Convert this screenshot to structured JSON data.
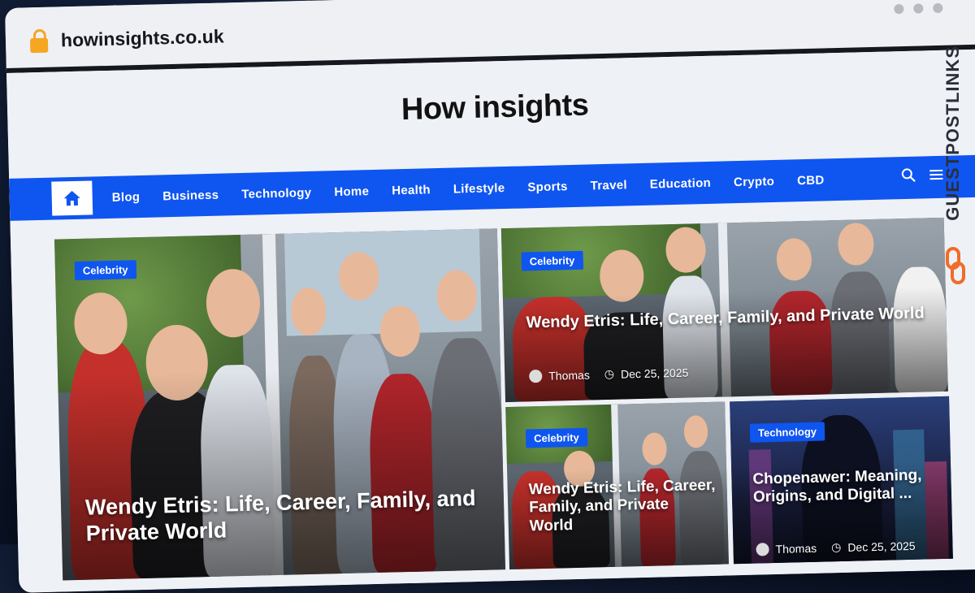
{
  "browser": {
    "url": "howinsights.co.uk"
  },
  "site": {
    "title": "How insights"
  },
  "nav": {
    "items": [
      "Blog",
      "Business",
      "Technology",
      "Home",
      "Health",
      "Lifestyle",
      "Sports",
      "Travel",
      "Education",
      "Crypto",
      "CBD"
    ]
  },
  "posts": {
    "main": {
      "category": "Celebrity",
      "title": "Wendy Etris: Life, Career, Family, and Private World"
    },
    "top_right": {
      "category": "Celebrity",
      "title": "Wendy Etris: Life, Career, Family, and Private World",
      "author": "Thomas",
      "date": "Dec 25, 2025"
    },
    "bottom_mid": {
      "category": "Celebrity",
      "title": "Wendy Etris: Life, Career, Family, and Private World"
    },
    "bottom_right": {
      "category": "Technology",
      "title": "Chopenawer: Meaning, Origins, and Digital ...",
      "author": "Thomas",
      "date": "Dec 25, 2025"
    }
  },
  "watermark": {
    "text": "GUESTPOSTLINKS"
  },
  "colors": {
    "accent": "#0f55f0",
    "page_bg": "#eef1f6",
    "brand_orange": "#f26b2a"
  }
}
